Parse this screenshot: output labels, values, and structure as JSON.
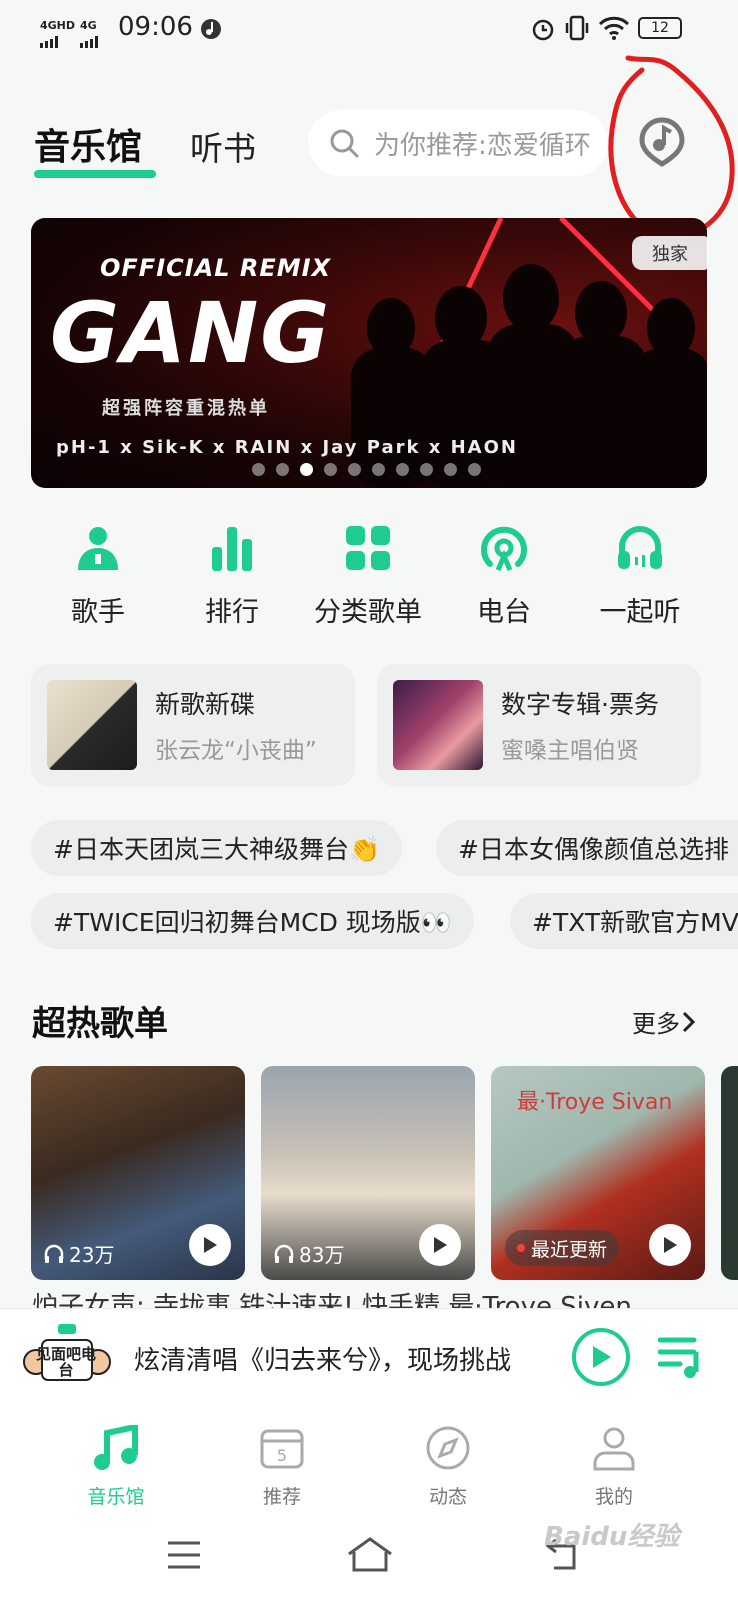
{
  "status_bar": {
    "network_1": "4GHD",
    "network_2": "4G",
    "time": "09:06",
    "battery": "12"
  },
  "header": {
    "tab_main": "音乐馆",
    "tab_book": "听书",
    "search_placeholder": "为你推荐:恋爱循环"
  },
  "banner": {
    "badge": "独家",
    "remix_text": "OFFICIAL REMIX",
    "title": "GANG",
    "subtitle": "超强阵容重混热单",
    "artists": "pH-1 x Sik-K x RAIN x Jay Park x HAON",
    "page_count": 10,
    "active_page": 3
  },
  "quick_entries": [
    {
      "label": "歌手",
      "icon": "singer-icon"
    },
    {
      "label": "排行",
      "icon": "chart-icon"
    },
    {
      "label": "分类歌单",
      "icon": "category-icon"
    },
    {
      "label": "电台",
      "icon": "radio-icon"
    },
    {
      "label": "一起听",
      "icon": "headphones-icon"
    }
  ],
  "cards": [
    {
      "title": "新歌新碟",
      "subtitle": "张云龙“小丧曲”"
    },
    {
      "title": "数字专辑·票务",
      "subtitle": "蜜嗓主唱伯贤"
    }
  ],
  "tags": [
    {
      "text": "#日本天团岚三大神级舞台👏"
    },
    {
      "text": "#日本女偶像颜值总选排"
    },
    {
      "text": "#TWICE回归初舞台MCD 现场版👀"
    },
    {
      "text": "#TXT新歌官方MV"
    }
  ],
  "section": {
    "title": "超热歌单",
    "more": "更多"
  },
  "playlists": [
    {
      "count": "23万"
    },
    {
      "count": "83万"
    },
    {
      "overlay": "最·Troye Sivan",
      "update": "最近更新"
    }
  ],
  "playlist_names_clipped": "炉子女声: 寺拢事  铁汁速来! 快手精  最·Troye Siven",
  "mini_player": {
    "logo_text": "见面吧电台",
    "title": "炫清清唱《归去来兮》，现场挑战"
  },
  "bottom_nav": [
    {
      "label": "音乐馆",
      "active": true
    },
    {
      "label": "推荐",
      "day": "5"
    },
    {
      "label": "动态"
    },
    {
      "label": "我的"
    }
  ],
  "watermark": "Baidu经验",
  "colors": {
    "accent": "#1fcc8f",
    "annotation": "#e02020"
  }
}
